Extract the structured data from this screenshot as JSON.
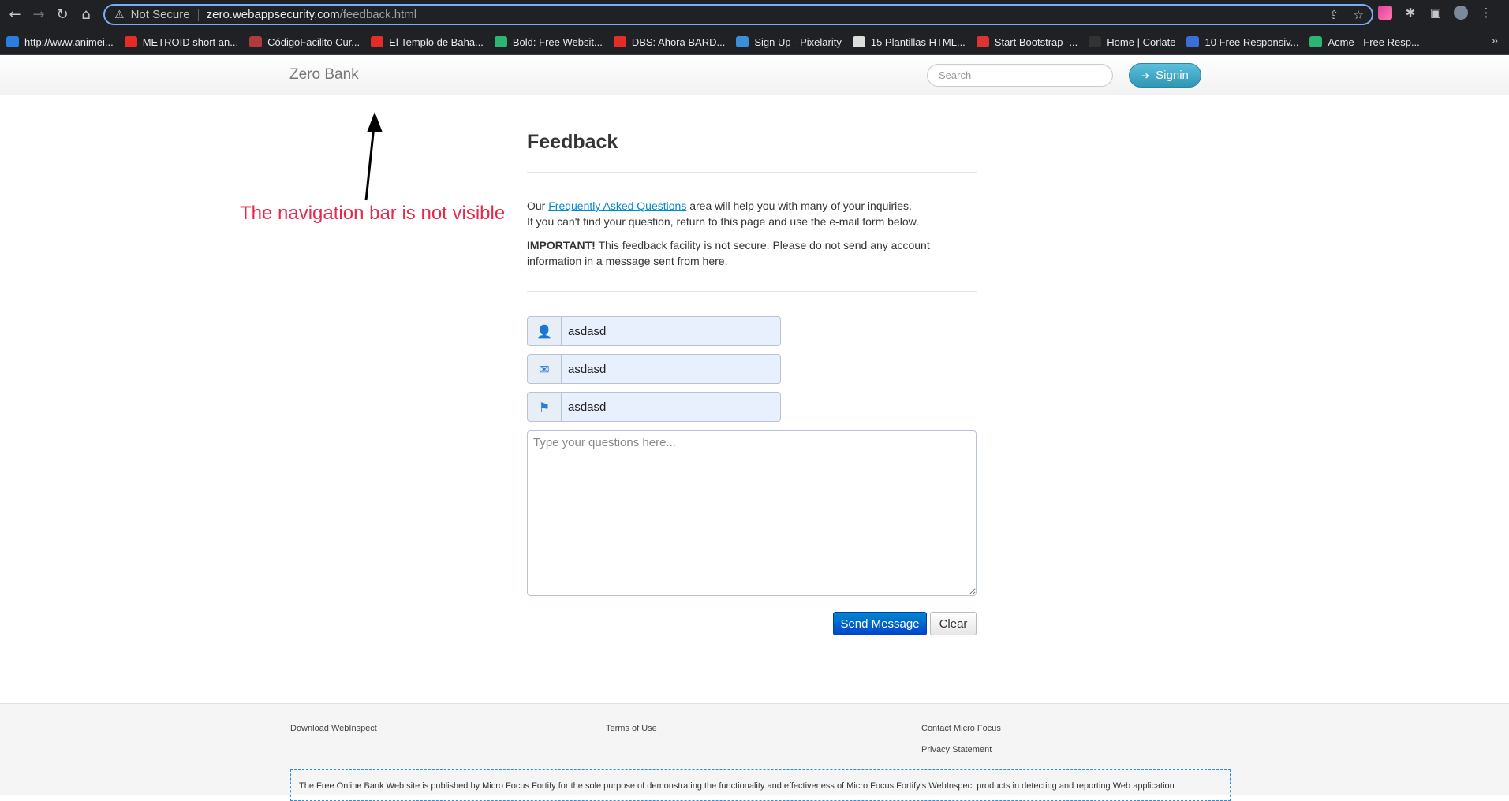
{
  "browser": {
    "security_label": "Not Secure",
    "url_host": "zero.webappsecurity.com",
    "url_path": "/feedback.html",
    "bookmarks": [
      {
        "label": "http://www.animei...",
        "color": "#2a7de1"
      },
      {
        "label": "METROID short an...",
        "color": "#e52d27"
      },
      {
        "label": "CódigoFacilito Cur...",
        "color": "#b33a3a"
      },
      {
        "label": "El Templo de Baha...",
        "color": "#e52d27"
      },
      {
        "label": "Bold: Free Websit...",
        "color": "#2bb673"
      },
      {
        "label": "DBS: Ahora BARD...",
        "color": "#e52d27"
      },
      {
        "label": "Sign Up - Pixelarity",
        "color": "#3a8fd8"
      },
      {
        "label": "15 Plantillas HTML...",
        "color": "#dddddd"
      },
      {
        "label": "Start Bootstrap -...",
        "color": "#dd3333"
      },
      {
        "label": "Home | Corlate",
        "color": "#333333"
      },
      {
        "label": "10 Free Responsiv...",
        "color": "#3a6fd8"
      },
      {
        "label": "Acme - Free Resp...",
        "color": "#2bb673"
      }
    ]
  },
  "header": {
    "brand": "Zero Bank",
    "search_placeholder": "Search",
    "signin_label": "Signin"
  },
  "annotation": {
    "text": "The navigation bar is not visible"
  },
  "main": {
    "title": "Feedback",
    "intro_prefix": "Our ",
    "faq_link": "Frequently Asked Questions",
    "intro_suffix": " area will help you with many of your inquiries.",
    "intro_line2": "If you can't find your question, return to this page and use the e-mail form below.",
    "important_label": "IMPORTANT!",
    "important_text": " This feedback facility is not secure. Please do not send any account information in a message sent from here.",
    "name_value": "asdasd",
    "email_value": "asdasd",
    "subject_value": "asdasd",
    "question_placeholder": "Type your questions here...",
    "send_label": "Send Message",
    "clear_label": "Clear"
  },
  "footer": {
    "download": "Download WebInspect",
    "terms": "Terms of Use",
    "contact": "Contact Micro Focus",
    "privacy": "Privacy Statement",
    "disclaimer": "The Free Online Bank Web site is published by Micro Focus Fortify for the sole purpose of demonstrating the functionality and effectiveness of Micro Focus Fortify's WebInspect products in detecting and reporting Web application"
  }
}
